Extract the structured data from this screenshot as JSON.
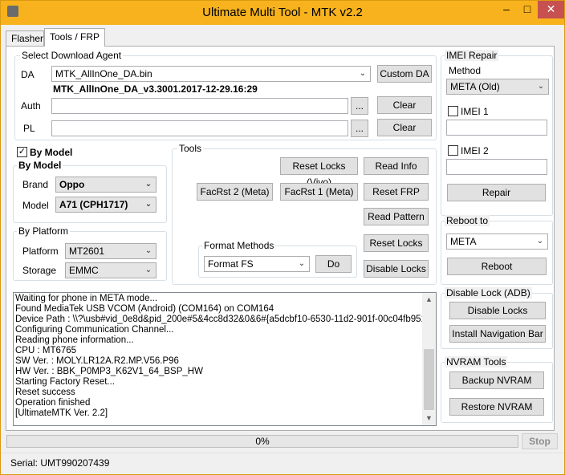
{
  "window": {
    "title": "Ultimate Multi Tool - MTK v2.2",
    "minimize": "–",
    "maximize": "□",
    "close": "✕"
  },
  "tabs": [
    {
      "label": "Flasher",
      "active": false
    },
    {
      "label": "Tools / FRP",
      "active": true
    }
  ],
  "download_agent": {
    "group_title": "Select Download Agent",
    "da_label": "DA",
    "da_value": "MTK_AllInOne_DA.bin",
    "custom_da_button": "Custom DA",
    "da_version": "MTK_AllInOne_DA_v3.3001.2017-12-29.16:29",
    "auth_label": "Auth",
    "auth_value": "",
    "pl_label": "PL",
    "pl_value": "",
    "browse_button": "...",
    "clear_button": "Clear"
  },
  "by_model": {
    "checkbox_label": "By Model",
    "checked": true,
    "group_title": "By Model",
    "brand_label": "Brand",
    "brand_value": "Oppo",
    "model_label": "Model",
    "model_value": "A71 (CPH1717)"
  },
  "by_platform": {
    "group_title": "By Platform",
    "platform_label": "Platform",
    "platform_value": "MT2601",
    "storage_label": "Storage",
    "storage_value": "EMMC"
  },
  "tools": {
    "group_title": "Tools",
    "reset_locks_vivo": "Reset Locks (Vivo)",
    "read_info": "Read Info",
    "facrst2": "FacRst 2 (Meta)",
    "facrst1": "FacRst 1 (Meta)",
    "reset_frp": "Reset FRP",
    "read_pattern": "Read Pattern",
    "reset_locks": "Reset Locks",
    "disable_locks": "Disable Locks",
    "format_methods_title": "Format Methods",
    "format_value": "Format FS",
    "do_button": "Do"
  },
  "log": {
    "lines": [
      "Waiting for phone in META mode...",
      "Found MediaTek USB VCOM (Android) (COM164) on COM164",
      "Device Path : \\\\?\\usb#vid_0e8d&pid_200e#5&4cc8d32&0&6#{a5dcbf10-6530-11d2-901f-00c04fb951ed}",
      "Configuring Communication Channel...",
      "Reading phone information...",
      "CPU : MT6765",
      "SW Ver. : MOLY.LR12A.R2.MP.V56.P96",
      "HW Ver. : BBK_P0MP3_K62V1_64_BSP_HW",
      "Starting Factory Reset...",
      "Reset success",
      "Operation finished",
      "[UltimateMTK Ver. 2.2]"
    ]
  },
  "imei_repair": {
    "group_title": "IMEI Repair",
    "method_label": "Method",
    "method_value": "META (Old)",
    "imei1_label": "IMEI 1",
    "imei1_value": "",
    "imei2_label": "IMEI 2",
    "imei2_value": "",
    "repair_button": "Repair"
  },
  "reboot": {
    "group_title": "Reboot to",
    "mode_value": "META",
    "reboot_button": "Reboot"
  },
  "disable_lock": {
    "group_title": "Disable Lock (ADB)",
    "disable_locks_button": "Disable Locks",
    "install_nav_button": "Install Navigation Bar"
  },
  "nvram": {
    "group_title": "NVRAM Tools",
    "backup_button": "Backup NVRAM",
    "restore_button": "Restore NVRAM"
  },
  "progress": {
    "percent": 0,
    "text": "0%",
    "stop_button": "Stop"
  },
  "status": {
    "serial": "Serial: UMT990207439"
  },
  "colors": {
    "titlebar": "#f7b21d",
    "progress_fill": "#06b025",
    "close_button": "#c75050"
  }
}
